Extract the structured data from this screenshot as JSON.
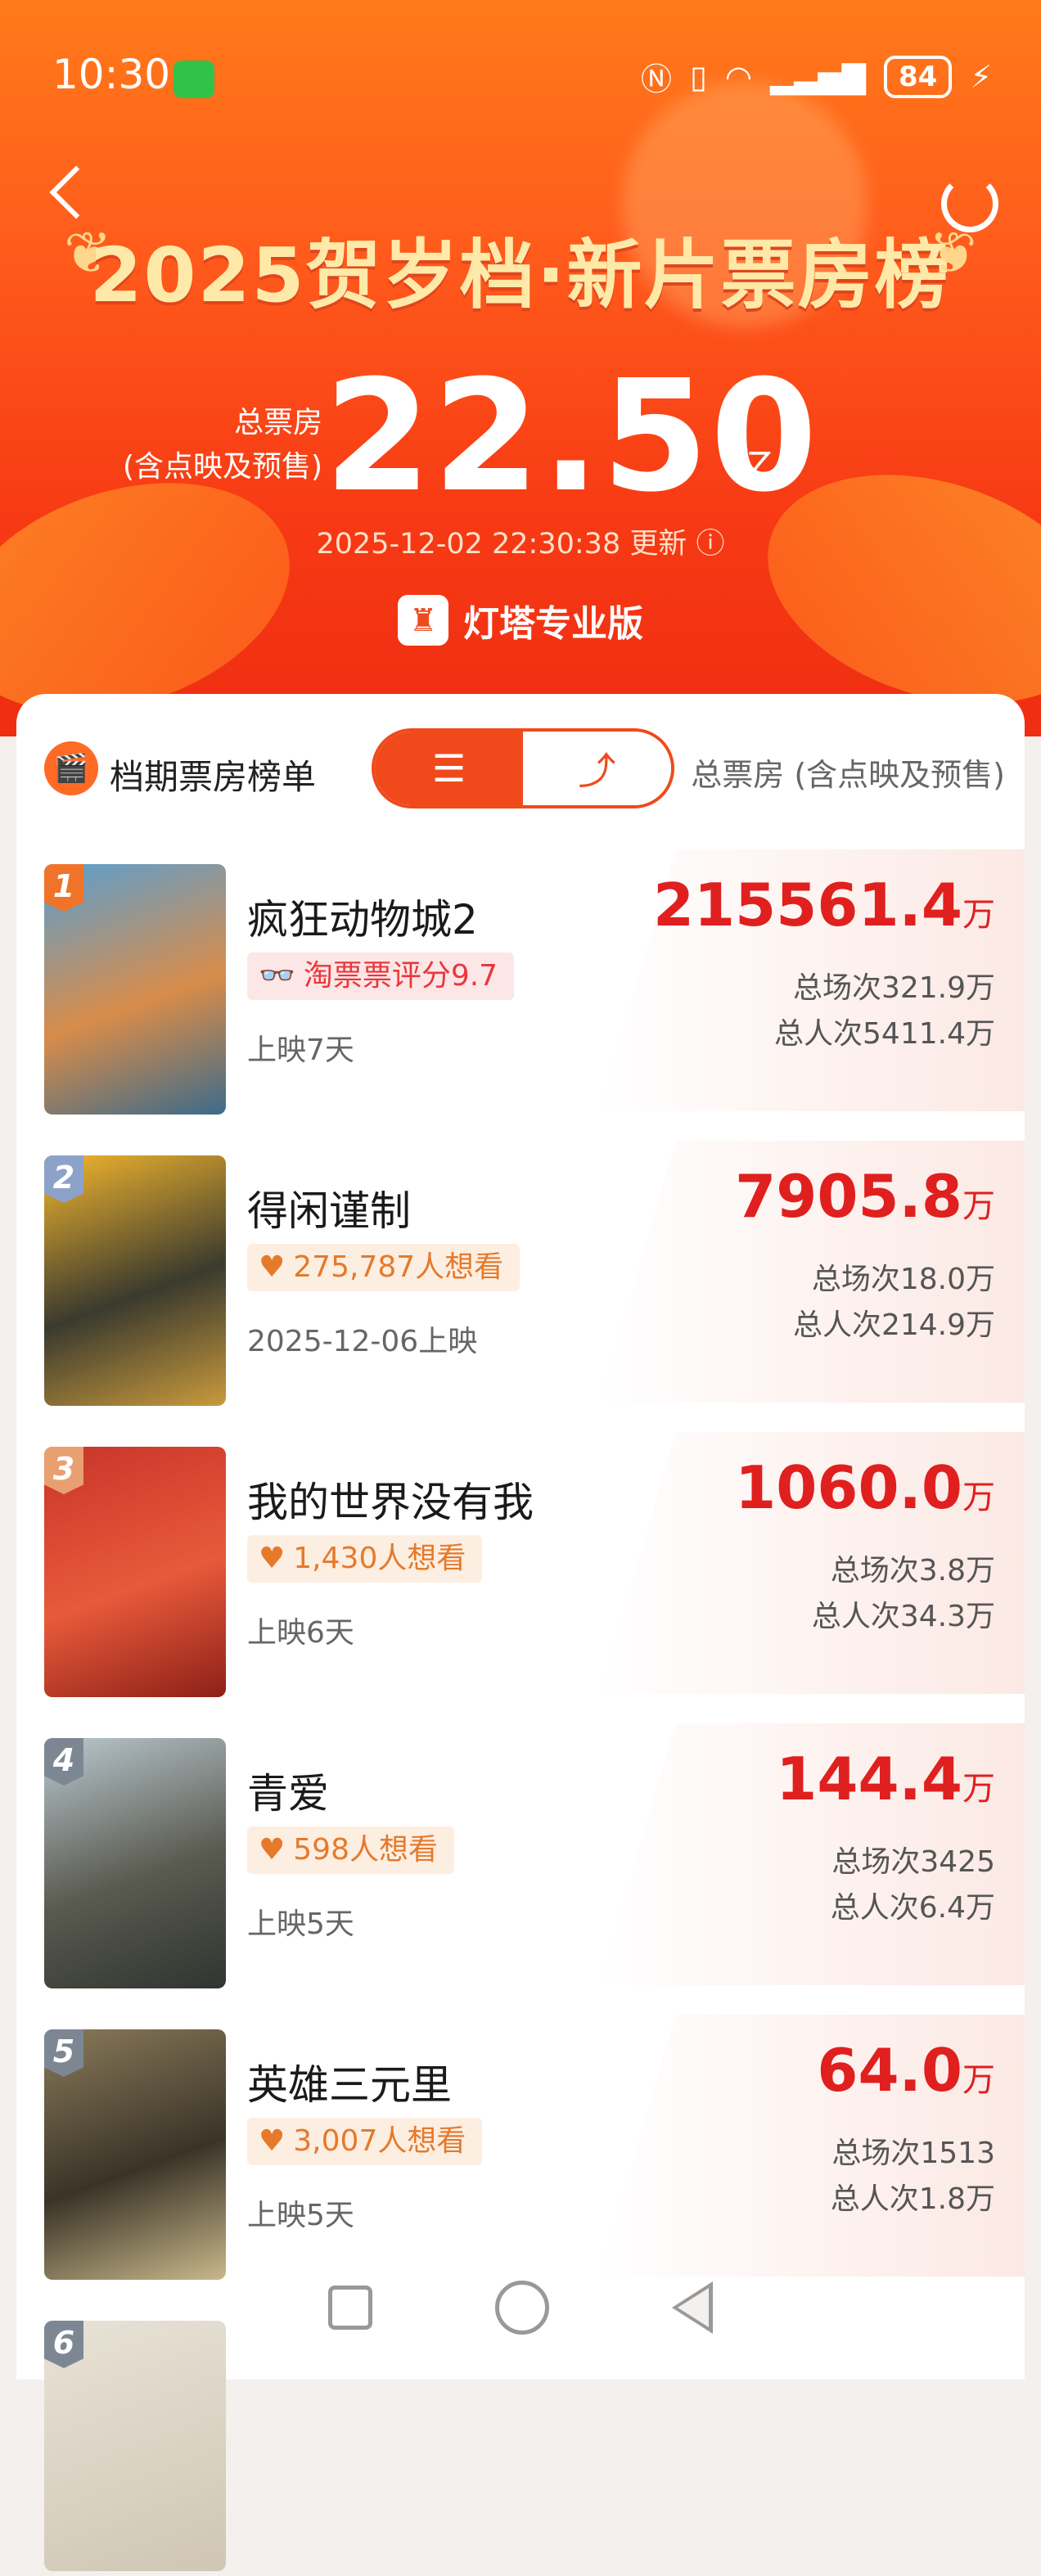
{
  "status_bar": {
    "time": "10:30",
    "battery": "84"
  },
  "header": {
    "title": "2025贺岁档·新片票房榜",
    "total_label_line1": "总票房",
    "total_label_line2": "(含点映及预售)",
    "total_value": "22.50",
    "total_unit": "亿",
    "updated": "2025-12-02 22:30:38 更新",
    "brand": "灯塔专业版"
  },
  "list_header": {
    "title": "档期票房榜单",
    "column_label": "总票房 (含点映及预售)",
    "view_list_icon": "list-icon",
    "view_chart_icon": "trend-chart-icon"
  },
  "movies": [
    {
      "rank": "1",
      "name": "疯狂动物城2",
      "tag": "淘票票评分9.7",
      "tag_type": "rating",
      "sub": "上映7天",
      "box": "215561.4",
      "unit": "万",
      "sessions": "总场次321.9万",
      "viewers": "总人次5411.4万",
      "rank_color": "#f0732a",
      "poster_colors": [
        "#5b9fd0",
        "#d88c4a",
        "#3d6b8a"
      ]
    },
    {
      "rank": "2",
      "name": "得闲谨制",
      "tag": "275,787人想看",
      "tag_type": "want",
      "sub": "2025-12-06上映",
      "box": "7905.8",
      "unit": "万",
      "sessions": "总场次18.0万",
      "viewers": "总人次214.9万",
      "rank_color": "#8da2c8",
      "poster_colors": [
        "#f3b62e",
        "#3a3a2e",
        "#c99a3c"
      ]
    },
    {
      "rank": "3",
      "name": "我的世界没有我",
      "tag": "1,430人想看",
      "tag_type": "want",
      "sub": "上映6天",
      "box": "1060.0",
      "unit": "万",
      "sessions": "总场次3.8万",
      "viewers": "总人次34.3万",
      "rank_color": "#e9a070",
      "poster_colors": [
        "#c8352a",
        "#e85a3a",
        "#8d2018"
      ]
    },
    {
      "rank": "4",
      "name": "青爱",
      "tag": "598人想看",
      "tag_type": "want",
      "sub": "上映5天",
      "box": "144.4",
      "unit": "万",
      "sessions": "总场次3425",
      "viewers": "总人次6.4万",
      "rank_color": "#7d8794",
      "poster_colors": [
        "#b9c8cf",
        "#5a5a50",
        "#2f3530"
      ]
    },
    {
      "rank": "5",
      "name": "英雄三元里",
      "tag": "3,007人想看",
      "tag_type": "want",
      "sub": "上映5天",
      "box": "64.0",
      "unit": "万",
      "sessions": "总场次1513",
      "viewers": "总人次1.8万",
      "rank_color": "#7d8794",
      "poster_colors": [
        "#8a7a5a",
        "#3a3428",
        "#c9b88a"
      ]
    }
  ],
  "partial_row": {
    "rank": "6"
  }
}
